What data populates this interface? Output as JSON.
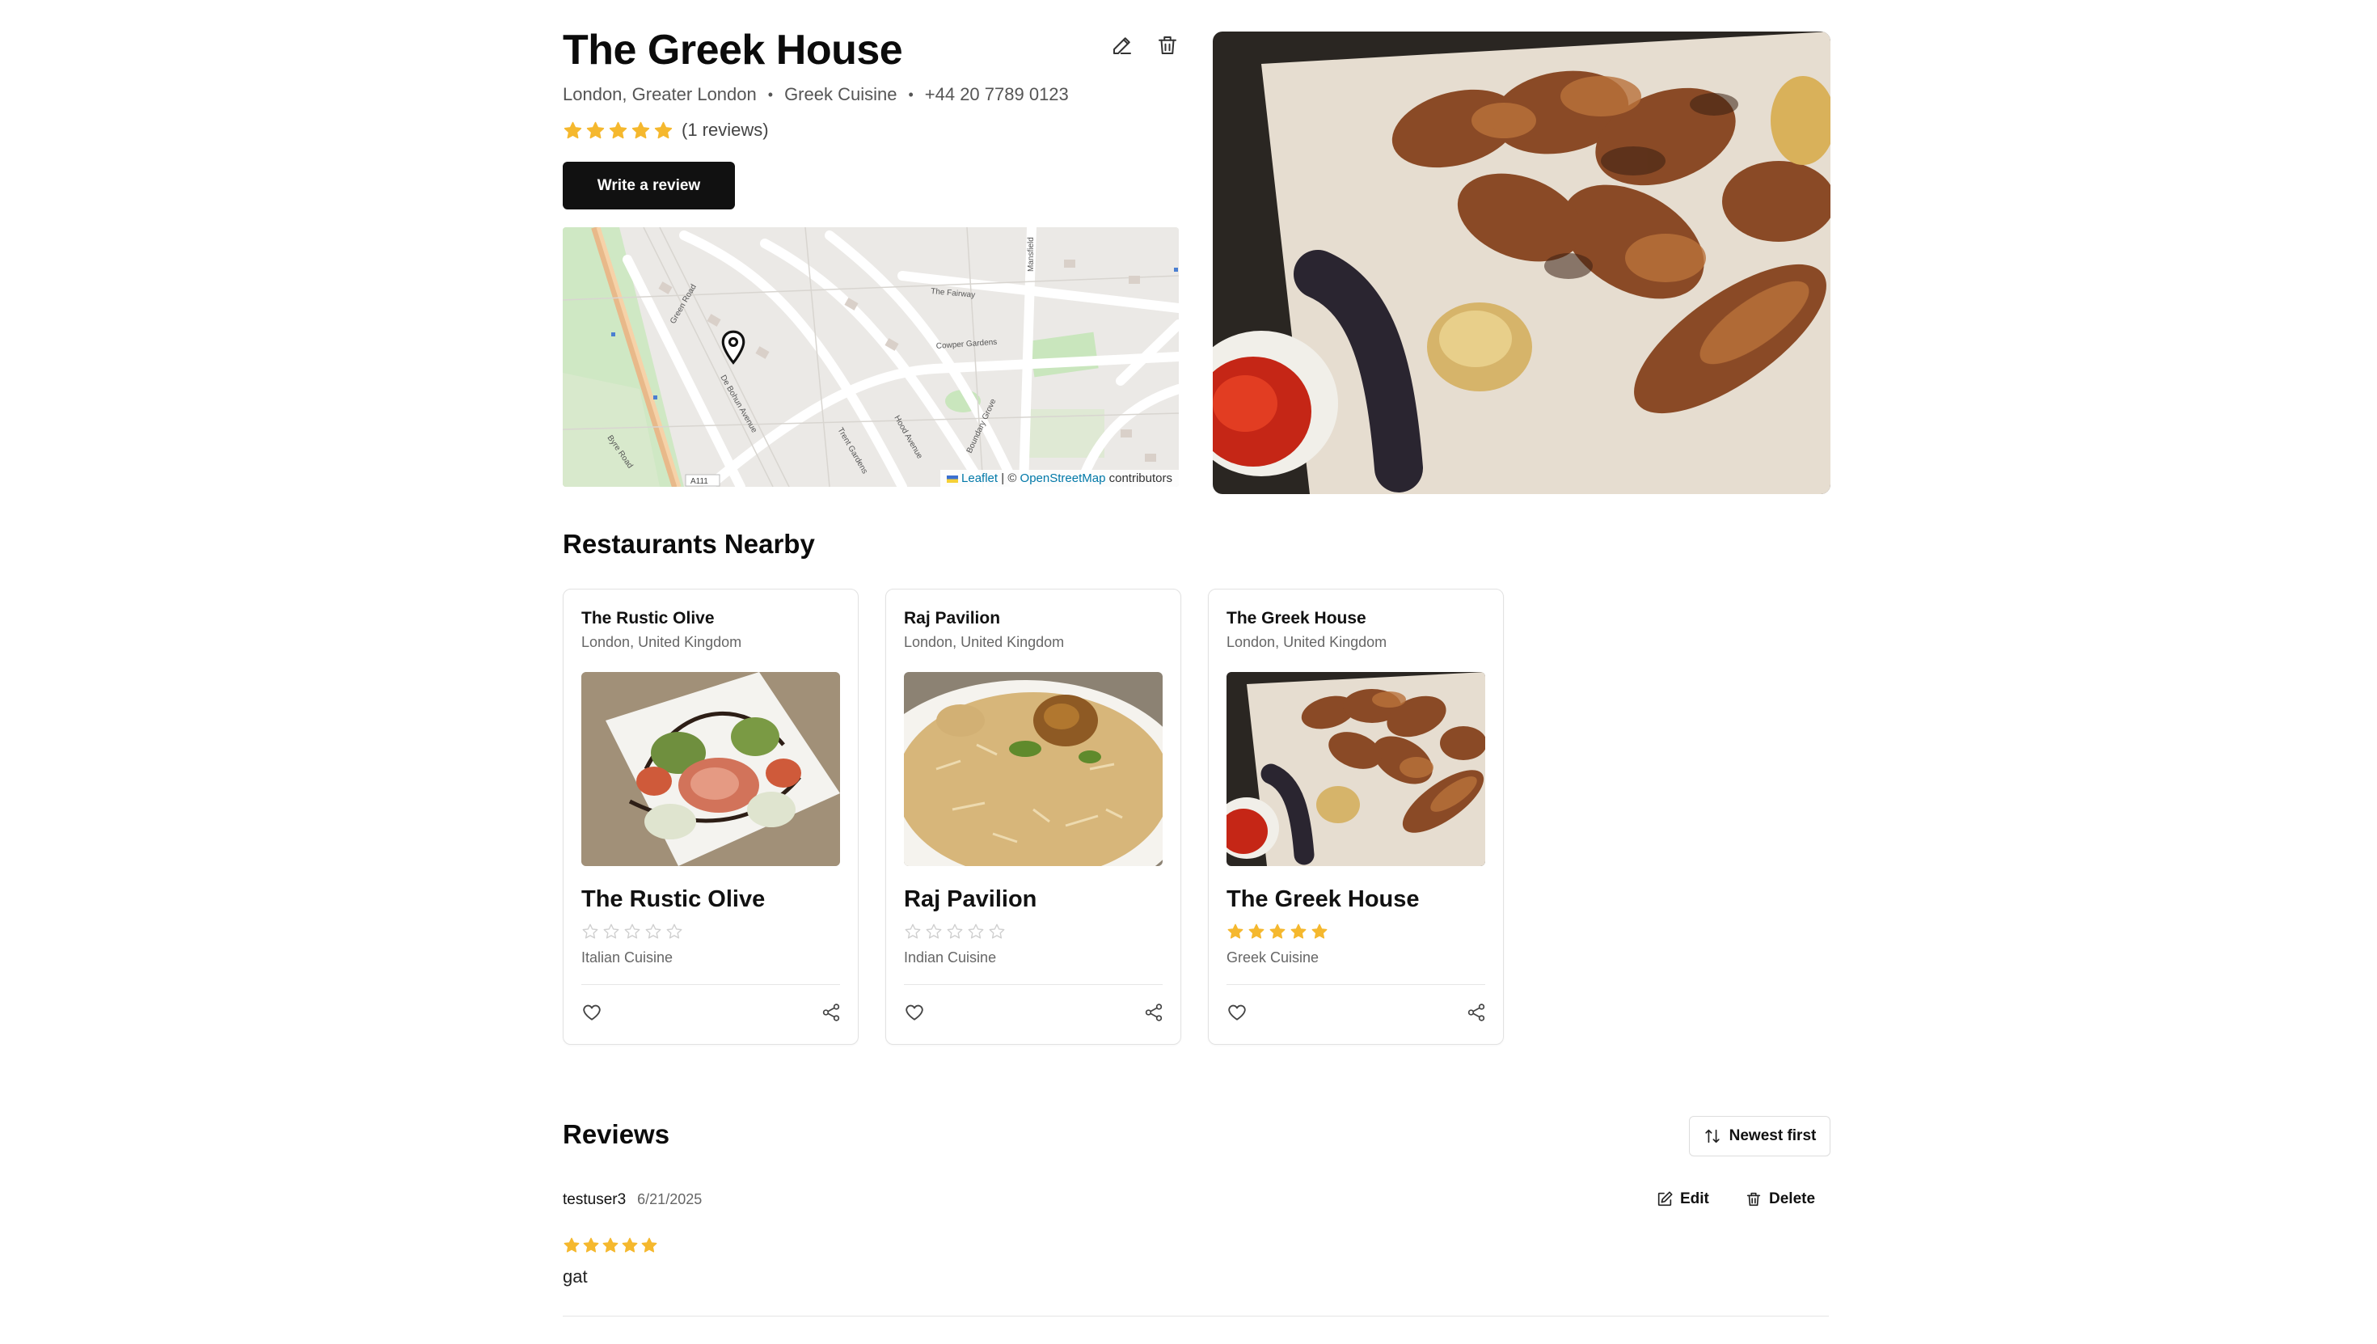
{
  "restaurant": {
    "name": "The Greek House",
    "location": "London, Greater London",
    "cuisine": "Greek Cuisine",
    "phone": "+44 20 7789 0123",
    "rating": 5,
    "reviews_count": "(1 reviews)",
    "write_review_label": "Write a review"
  },
  "map": {
    "attribution_leaflet": "Leaflet",
    "attribution_sep": "| ©",
    "attribution_osm": "OpenStreetMap",
    "attribution_suffix": "contributors",
    "streets": {
      "the_fairway": "The Fairway",
      "cowper_gardens": "Cowper Gardens",
      "green_road": "Green Road",
      "de_bohun_avenue": "De Bohun Avenue",
      "trent_gardens": "Trent Gardens",
      "hood_avenue": "Hood Avenue",
      "boundary_grove": "Boundary Grove",
      "mansfield": "Mansfield",
      "a111": "A111",
      "byre_road": "Byre Road"
    }
  },
  "nearby": {
    "heading": "Restaurants Nearby",
    "cards": [
      {
        "name": "The Rustic Olive",
        "location": "London, United Kingdom",
        "title": "The Rustic Olive",
        "rating": 0,
        "cuisine": "Italian Cuisine",
        "image": "italian-plate"
      },
      {
        "name": "Raj Pavilion",
        "location": "London, United Kingdom",
        "title": "Raj Pavilion",
        "rating": 0,
        "cuisine": "Indian Cuisine",
        "image": "biryani-plate"
      },
      {
        "name": "The Greek House",
        "location": "London, United Kingdom",
        "title": "The Greek House",
        "rating": 5,
        "cuisine": "Greek Cuisine",
        "image": "grill-platter"
      }
    ]
  },
  "reviews": {
    "heading": "Reviews",
    "sort_label": "Newest first",
    "items": [
      {
        "user": "testuser3",
        "date": "6/21/2025",
        "rating": 5,
        "text": "gat",
        "edit_label": "Edit",
        "delete_label": "Delete"
      }
    ]
  },
  "colors": {
    "star_filled": "#f5b82e",
    "star_empty": "#cfcfcf",
    "primary_button": "#111111",
    "link": "#0078a8"
  },
  "icons": [
    "pencil-icon",
    "trash-icon",
    "star-icon",
    "map-pin-icon",
    "heart-icon",
    "share-icon",
    "sort-arrows-icon",
    "edit-icon"
  ]
}
